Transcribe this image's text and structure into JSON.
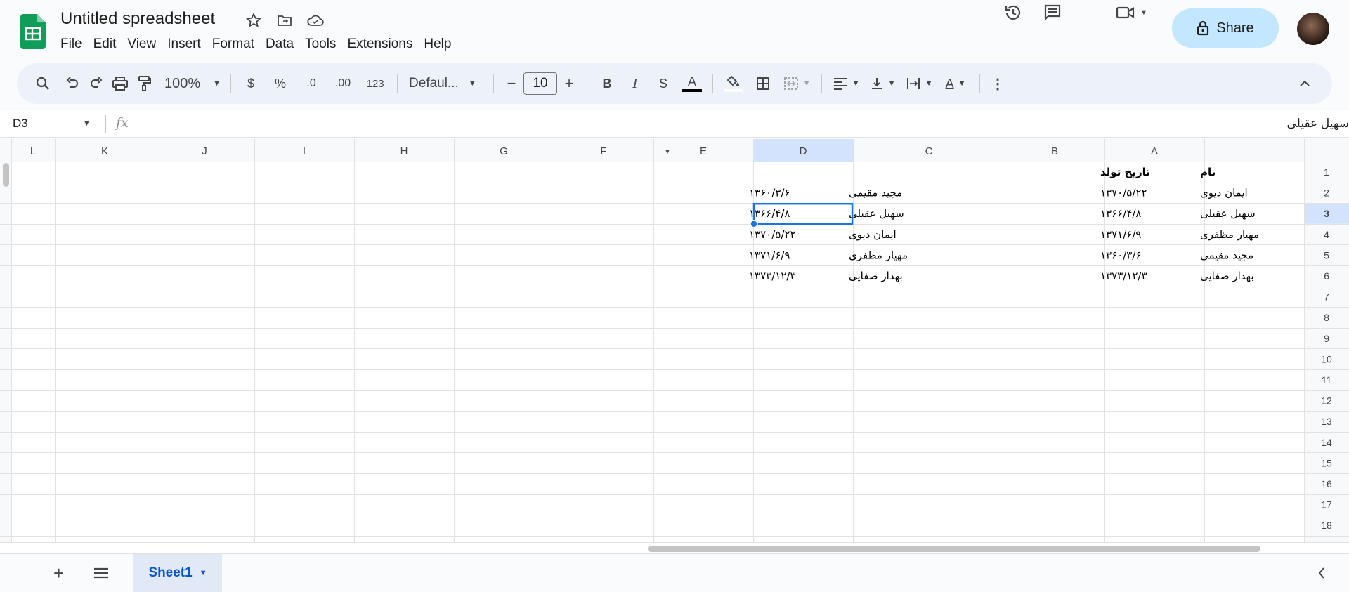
{
  "app": {
    "title": "Untitled spreadsheet",
    "menu": [
      "File",
      "Edit",
      "View",
      "Insert",
      "Format",
      "Data",
      "Tools",
      "Extensions",
      "Help"
    ],
    "share_label": "Share"
  },
  "toolbar": {
    "zoom": "100%",
    "currency": "$",
    "percent": "%",
    "dec_decrease": ".0",
    "dec_increase": ".00",
    "number_format": "123",
    "font": "Defaul...",
    "font_size": "10",
    "bold": "B",
    "italic": "I",
    "strike": "S",
    "text_color": "A",
    "text_color_value": "#000000",
    "rotate": "A"
  },
  "formula_bar": {
    "cell_ref": "D3",
    "fx": "fx",
    "value": "سهیل عقیلی"
  },
  "grid": {
    "columns": [
      "L",
      "K",
      "J",
      "I",
      "H",
      "G",
      "F",
      "E",
      "D",
      "C",
      "B",
      "A"
    ],
    "row_numbers": [
      "1",
      "2",
      "3",
      "4",
      "5",
      "6",
      "7",
      "8",
      "9",
      "10",
      "11",
      "12",
      "13",
      "14",
      "15",
      "16",
      "17",
      "18"
    ],
    "selected_cell": "D3",
    "cells": {
      "A": [
        "نام",
        "ایمان دیوی",
        "سهیل عقیلی",
        "مهیار مظفری",
        "مجید مقیمی",
        "بهدار صفایی"
      ],
      "B": [
        "تاریخ تولد",
        "۱۳۷۰/۵/۲۲",
        "۱۳۶۶/۴/۸",
        "۱۳۷۱/۶/۹",
        "۱۳۶۰/۳/۶",
        "۱۳۷۳/۱۲/۳"
      ],
      "D": [
        "",
        "مجید مقیمی",
        "سهیل عقیلی",
        "ایمان دیوی",
        "مهیار مظفری",
        "بهدار صفایی"
      ],
      "E": [
        "",
        "۱۳۶۰/۳/۶",
        "۱۳۶۶/۴/۸",
        "۱۳۷۰/۵/۲۲",
        "۱۳۷۱/۶/۹",
        "۱۳۷۳/۱۲/۳"
      ]
    }
  },
  "sheets": {
    "tabs": [
      {
        "label": "Sheet1"
      }
    ],
    "add_label": "+"
  },
  "colors": {
    "accent": "#0b57d0",
    "share_bg": "#c2e7ff",
    "selected_header": "#d3e3fd",
    "selection_border": "#1a73e8"
  }
}
